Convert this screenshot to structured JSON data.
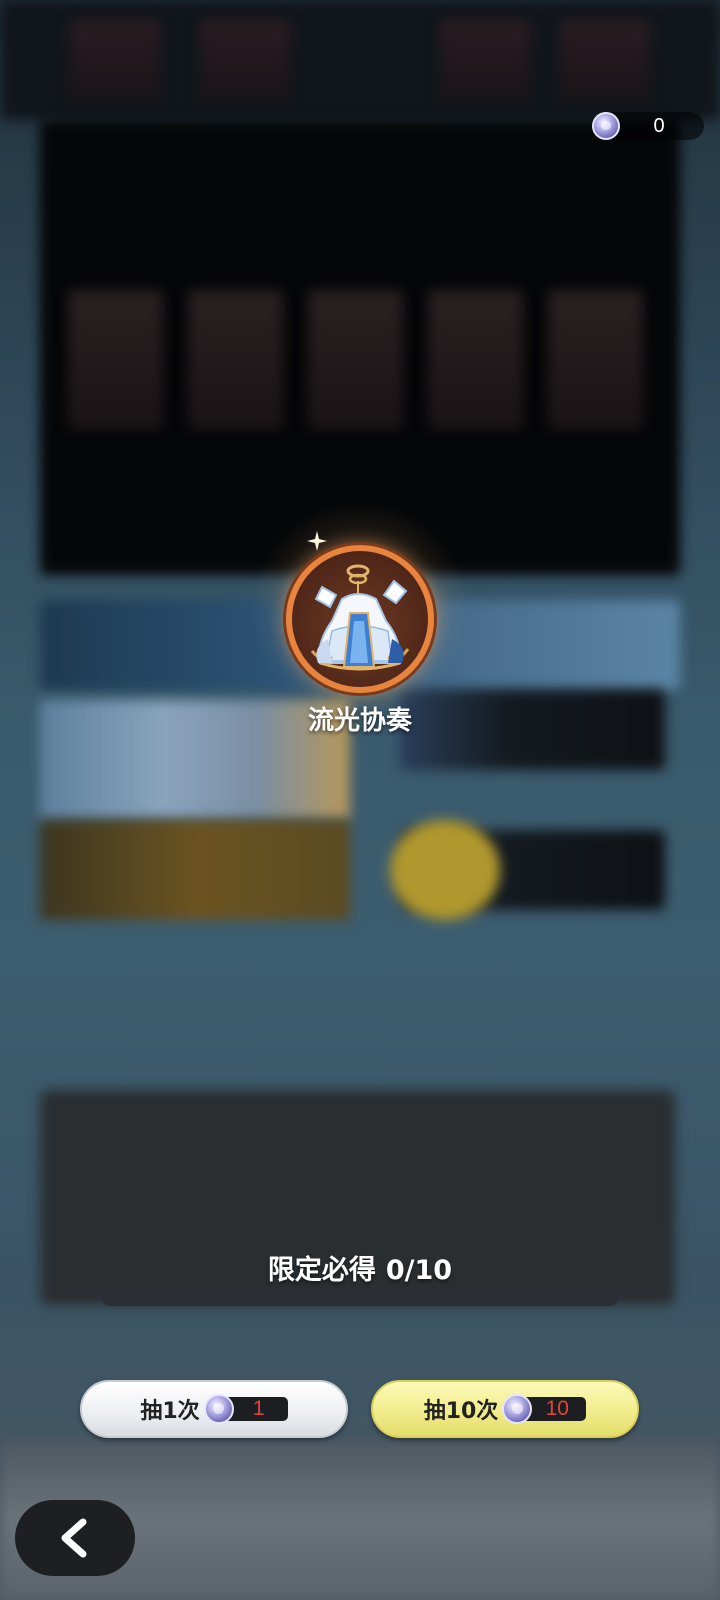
{
  "currency": {
    "icon": "gacha-coin-icon",
    "amount": "0"
  },
  "reward": {
    "name": "流光协奏",
    "icon": "costume-outfit-icon",
    "frame_color": "#e8843e"
  },
  "guarantee": {
    "label": "限定必得",
    "progress_text": "0/10",
    "current": 0,
    "total": 10
  },
  "draw_buttons": [
    {
      "label": "抽1次",
      "cost": "1",
      "icon": "gacha-coin-icon",
      "color": "#eef0f3"
    },
    {
      "label": "抽10次",
      "cost": "10",
      "icon": "gacha-coin-icon",
      "color": "#f1ec8c"
    }
  ],
  "back_button": {
    "icon": "back-arrow-icon"
  },
  "colors": {
    "cost_text": "#e0453a",
    "progress_track": "#2b2f33"
  }
}
